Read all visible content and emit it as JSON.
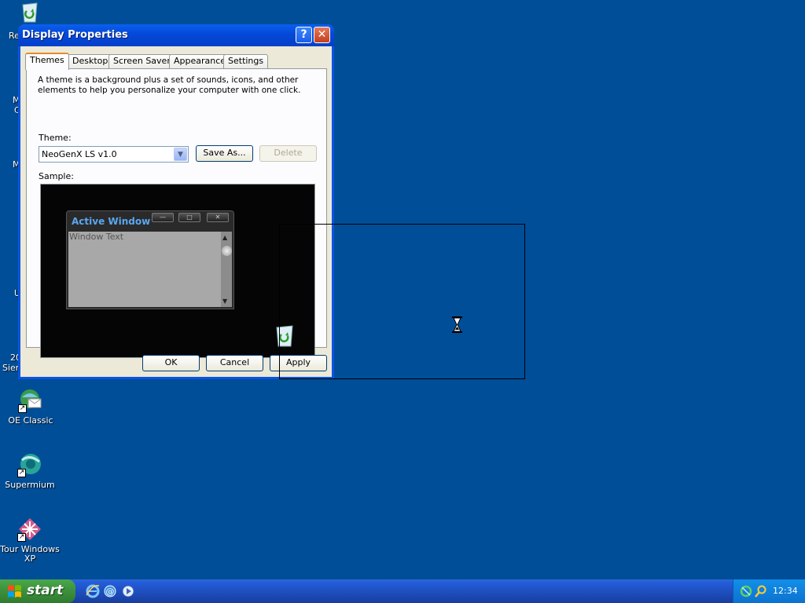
{
  "desktop": {
    "icons": [
      {
        "label": "OE Classic"
      },
      {
        "label": "Supermium"
      },
      {
        "label": "Tour Windows XP"
      }
    ],
    "partial_labels": [
      "Re",
      "M",
      "C",
      "M",
      "U",
      "20",
      "Sier"
    ]
  },
  "window": {
    "title": "Display Properties",
    "help_glyph": "?",
    "close_glyph": "✕",
    "tabs": [
      {
        "label": "Themes"
      },
      {
        "label": "Desktop"
      },
      {
        "label": "Screen Saver"
      },
      {
        "label": "Appearance"
      },
      {
        "label": "Settings"
      }
    ],
    "description": "A theme is a background plus a set of sounds, icons, and other elements to help you personalize your computer with one click.",
    "theme_label": "Theme:",
    "theme_value": "NeoGenX LS v1.0",
    "save_as_label": "Save As...",
    "delete_label": "Delete",
    "sample_label": "Sample:",
    "sample": {
      "window_title": "Active Window",
      "window_text": "Window Text"
    },
    "ok_label": "OK",
    "cancel_label": "Cancel",
    "apply_label": "Apply"
  },
  "taskbar": {
    "start_label": "start",
    "clock": "12:34"
  }
}
